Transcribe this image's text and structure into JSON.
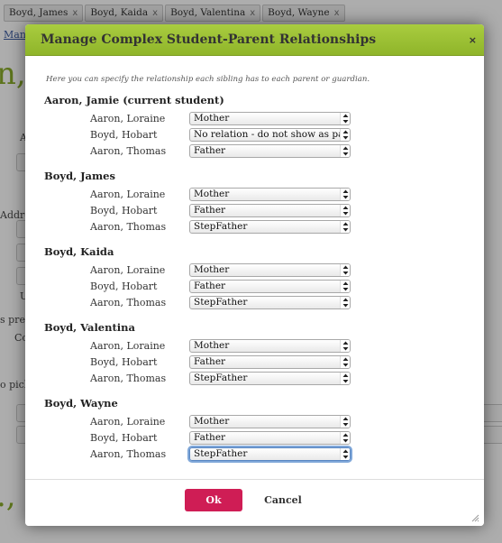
{
  "background": {
    "tags": [
      "Boyd, James",
      "Boyd, Kaida",
      "Boyd, Valentina",
      "Boyd, Wayne"
    ],
    "tag_close": "x",
    "link_fragment": "Mana",
    "heading_fragment_1": "n,",
    "heading_fragment_2": "., F",
    "fragments": [
      "Addres",
      "s pref",
      "Co",
      "o pick-",
      "U",
      "A"
    ]
  },
  "dialog": {
    "title": "Manage Complex Student-Parent Relationships",
    "close_glyph": "×",
    "intro": "Here you can specify the relationship each sibling has to each parent or guardian.",
    "students": [
      {
        "name": "Aaron, Jamie (current student)",
        "relations": [
          {
            "parent": "Aaron, Loraine",
            "value": "Mother"
          },
          {
            "parent": "Boyd, Hobart",
            "value": "No relation - do not show as parent"
          },
          {
            "parent": "Aaron, Thomas",
            "value": "Father"
          }
        ]
      },
      {
        "name": "Boyd, James",
        "relations": [
          {
            "parent": "Aaron, Loraine",
            "value": "Mother"
          },
          {
            "parent": "Boyd, Hobart",
            "value": "Father"
          },
          {
            "parent": "Aaron, Thomas",
            "value": "StepFather"
          }
        ]
      },
      {
        "name": "Boyd, Kaida",
        "relations": [
          {
            "parent": "Aaron, Loraine",
            "value": "Mother"
          },
          {
            "parent": "Boyd, Hobart",
            "value": "Father"
          },
          {
            "parent": "Aaron, Thomas",
            "value": "StepFather"
          }
        ]
      },
      {
        "name": "Boyd, Valentina",
        "relations": [
          {
            "parent": "Aaron, Loraine",
            "value": "Mother"
          },
          {
            "parent": "Boyd, Hobart",
            "value": "Father"
          },
          {
            "parent": "Aaron, Thomas",
            "value": "StepFather"
          }
        ]
      },
      {
        "name": "Boyd, Wayne",
        "relations": [
          {
            "parent": "Aaron, Loraine",
            "value": "Mother"
          },
          {
            "parent": "Boyd, Hobart",
            "value": "Father"
          },
          {
            "parent": "Aaron, Thomas",
            "value": "StepFather"
          }
        ]
      }
    ],
    "focused_select": "Boyd, Wayne / Aaron, Thomas",
    "ok_label": "Ok",
    "cancel_label": "Cancel"
  },
  "colors": {
    "titlebar": "#9cc133",
    "ok_button": "#cf1d55",
    "heading_green": "#8aab2a"
  },
  "icons": {
    "close": "close-icon",
    "select_arrows": "updown-arrows-icon",
    "resize": "resize-grip-icon"
  }
}
